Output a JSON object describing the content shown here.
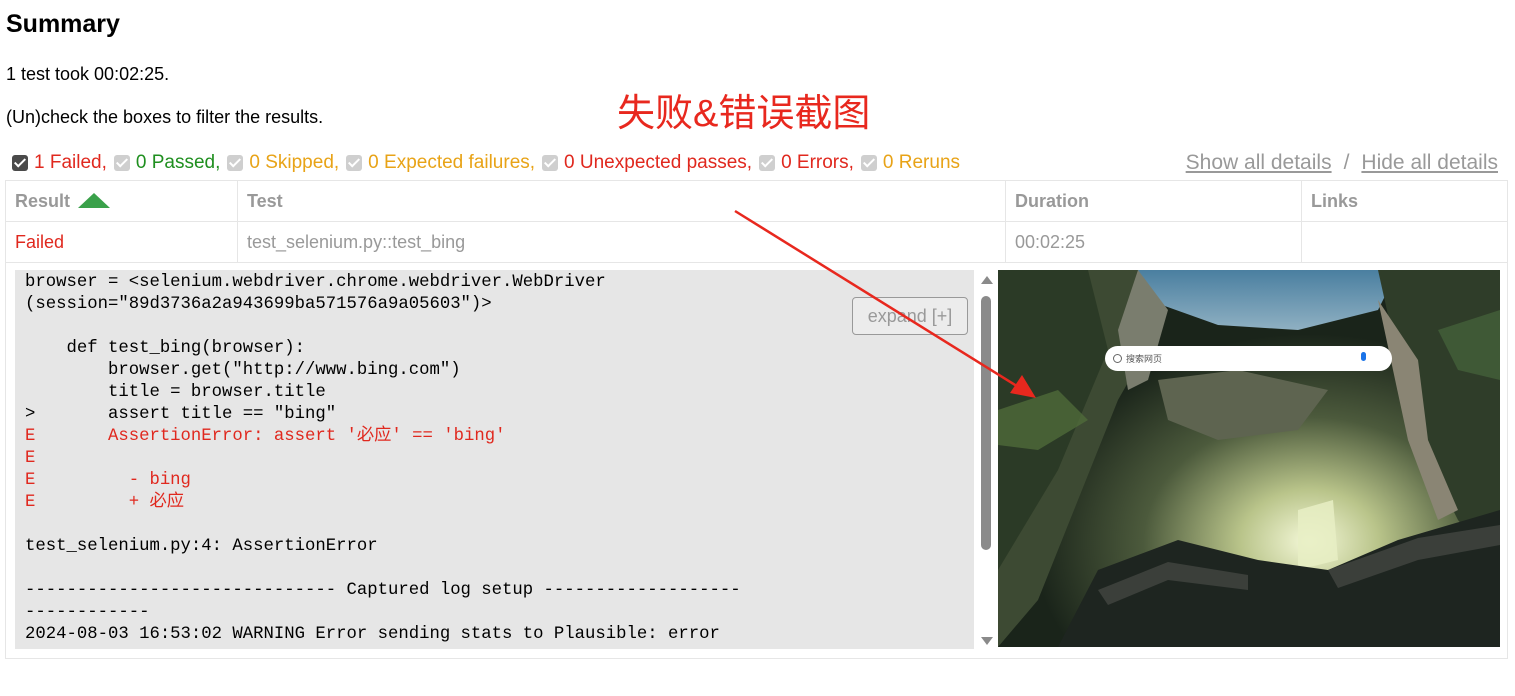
{
  "summary": {
    "heading": "Summary",
    "duration_text": "1 test took 00:02:25.",
    "filter_hint": "(Un)check the boxes to filter the results."
  },
  "annotation": {
    "title": "失败&错误截图",
    "color": "#e8281e"
  },
  "filters": [
    {
      "label": "1 Failed,",
      "checked": true,
      "enabled": true,
      "color": "#e0281e"
    },
    {
      "label": "0 Passed,",
      "checked": true,
      "enabled": false,
      "color": "#1f8f1f"
    },
    {
      "label": "0 Skipped,",
      "checked": true,
      "enabled": false,
      "color": "#e8a317"
    },
    {
      "label": "0 Expected failures,",
      "checked": true,
      "enabled": false,
      "color": "#e8a317"
    },
    {
      "label": "0 Unexpected passes,",
      "checked": true,
      "enabled": false,
      "color": "#e0281e"
    },
    {
      "label": "0 Errors,",
      "checked": true,
      "enabled": false,
      "color": "#e0281e"
    },
    {
      "label": "0 Reruns",
      "checked": true,
      "enabled": false,
      "color": "#e8a317"
    }
  ],
  "details_links": {
    "show": "Show all details",
    "separator": "/",
    "hide": "Hide all details"
  },
  "table": {
    "headers": {
      "result": "Result",
      "test": "Test",
      "duration": "Duration",
      "links": "Links"
    },
    "sorted_column": "result",
    "rows": [
      {
        "result": "Failed",
        "test": "test_selenium.py::test_bing",
        "duration": "00:02:25",
        "links": ""
      }
    ]
  },
  "log": {
    "expand_label": "expand [+]",
    "lines": [
      {
        "text": "browser = <selenium.webdriver.chrome.webdriver.WebDriver",
        "error": false
      },
      {
        "text": "(session=\"89d3736a2a943699ba571576a9a05603\")>",
        "error": false
      },
      {
        "text": "",
        "error": false
      },
      {
        "text": "    def test_bing(browser):",
        "error": false
      },
      {
        "text": "        browser.get(\"http://www.bing.com\")",
        "error": false
      },
      {
        "text": "        title = browser.title",
        "error": false
      },
      {
        "text": ">       assert title == \"bing\"",
        "error": false
      },
      {
        "text": "E       AssertionError: assert '必应' == 'bing'",
        "error": true
      },
      {
        "text": "E",
        "error": true
      },
      {
        "text": "E         - bing",
        "error": true
      },
      {
        "text": "E         + 必应",
        "error": true
      },
      {
        "text": "",
        "error": false
      },
      {
        "text": "test_selenium.py:4: AssertionError",
        "error": false
      },
      {
        "text": "",
        "error": false
      },
      {
        "text": "------------------------------ Captured log setup -------------------",
        "error": false
      },
      {
        "text": "------------",
        "error": false
      },
      {
        "text": "2024-08-03 16:53:02 WARNING Error sending stats to Plausible: error",
        "error": false
      }
    ]
  },
  "screenshot": {
    "search_placeholder": "搜索网页"
  }
}
